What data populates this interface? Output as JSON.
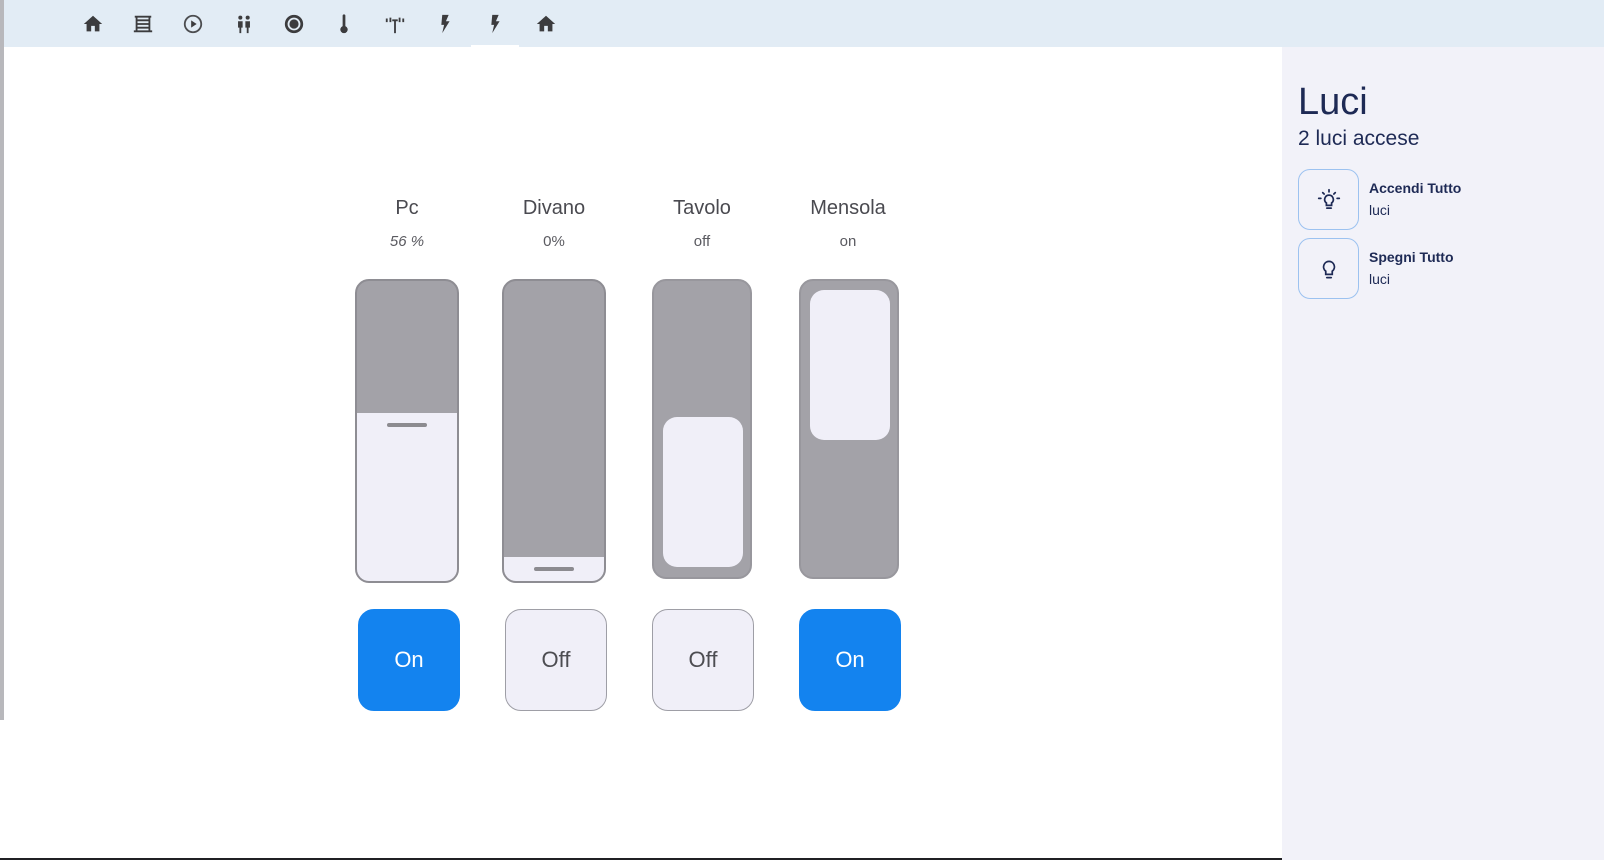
{
  "topbar": {
    "tabs": [
      {
        "icon": "home-icon"
      },
      {
        "icon": "blinds-icon"
      },
      {
        "icon": "media-play-icon"
      },
      {
        "icon": "people-icon"
      },
      {
        "icon": "robot-vacuum-icon"
      },
      {
        "icon": "thermometer-icon"
      },
      {
        "icon": "antenna-icon"
      },
      {
        "icon": "lightning-icon"
      },
      {
        "icon": "lightning-icon",
        "active": true
      },
      {
        "icon": "home-icon"
      }
    ]
  },
  "lights": [
    {
      "name": "Pc",
      "state": "56 %",
      "control": "slider",
      "level_percent": 56,
      "button": "On",
      "button_on": true
    },
    {
      "name": "Divano",
      "state": "0%",
      "control": "slider",
      "level_percent": 0,
      "button": "Off",
      "button_on": false
    },
    {
      "name": "Tavolo",
      "state": "off",
      "control": "switch",
      "switch_on": false,
      "button": "Off",
      "button_on": false
    },
    {
      "name": "Mensola",
      "state": "on",
      "control": "switch",
      "switch_on": true,
      "button": "On",
      "button_on": true
    }
  ],
  "sidebar": {
    "title": "Luci",
    "subtitle": "2 luci accese",
    "actions": [
      {
        "title": "Accendi Tutto",
        "subtitle": "luci",
        "icon": "lightbulb-on-icon"
      },
      {
        "title": "Spegni Tutto",
        "subtitle": "luci",
        "icon": "lightbulb-off-icon"
      }
    ]
  },
  "colors": {
    "accent": "#1383ef",
    "topbar": "#e2ecf5",
    "sidebar": "#f2f2f9",
    "slider_track": "#a3a2a8",
    "slider_fill": "#f0eff8",
    "title_text": "#1e2a55"
  }
}
